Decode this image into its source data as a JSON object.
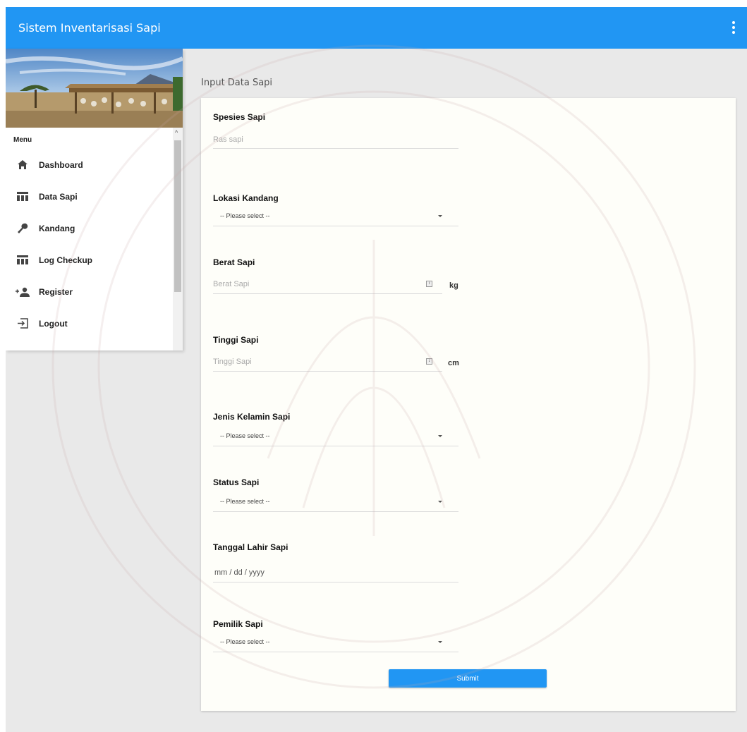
{
  "app": {
    "title": "Sistem Inventarisasi Sapi"
  },
  "sidebar": {
    "menu_label": "Menu",
    "items": [
      {
        "label": "Dashboard",
        "icon": "home-icon"
      },
      {
        "label": "Data Sapi",
        "icon": "table-icon"
      },
      {
        "label": "Kandang",
        "icon": "wrench-icon"
      },
      {
        "label": "Log Checkup",
        "icon": "table-icon"
      },
      {
        "label": "Register",
        "icon": "add-person-icon"
      },
      {
        "label": "Logout",
        "icon": "logout-icon"
      }
    ]
  },
  "page": {
    "heading": "Input Data Sapi"
  },
  "form": {
    "species": {
      "label": "Spesies Sapi",
      "placeholder": "Ras sapi"
    },
    "location": {
      "label": "Lokasi Kandang",
      "value": "-- Please select --"
    },
    "weight": {
      "label": "Berat Sapi",
      "placeholder": "Berat Sapi",
      "unit": "kg"
    },
    "height": {
      "label": "Tinggi Sapi",
      "placeholder": "Tinggi Sapi",
      "unit": "cm"
    },
    "sex": {
      "label": "Jenis Kelamin Sapi",
      "value": "-- Please select --"
    },
    "status": {
      "label": "Status Sapi",
      "value": "-- Please select --"
    },
    "birthdate": {
      "label": "Tanggal Lahir Sapi",
      "value": "mm / dd / yyyy"
    },
    "owner": {
      "label": "Pemilik Sapi",
      "value": "-- Please select --"
    },
    "submit_label": "Submit"
  },
  "colors": {
    "primary": "#2196f3",
    "background": "#e9e9e9",
    "card": "#fefef9"
  }
}
